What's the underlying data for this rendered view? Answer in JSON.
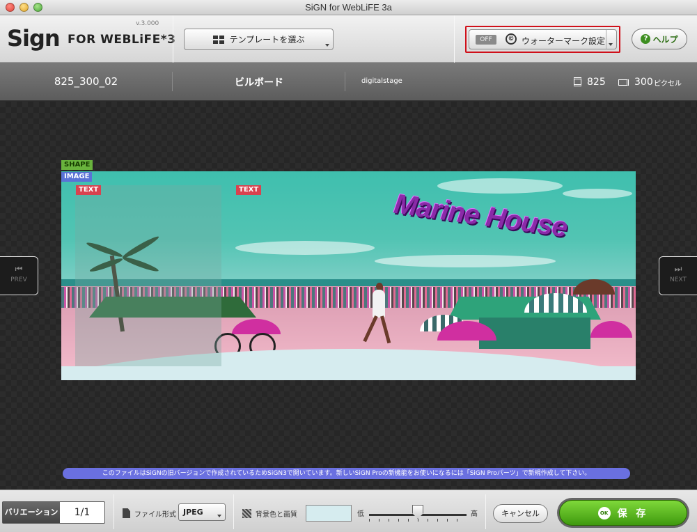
{
  "window": {
    "title": "SiGN for WebLiFE 3a"
  },
  "toolbar": {
    "logo_sign": "Sign",
    "logo_rest": "FOR WEBLiFE*3",
    "version": "v.3.000",
    "template_button": "テンプレートを選ぶ",
    "watermark_toggle": "OFF",
    "watermark_icon": "©",
    "watermark_button": "ウォーターマーク設定",
    "help_icon": "?",
    "help_button": "ヘルプ",
    "highlight_color": "#d0101a"
  },
  "info": {
    "template_name": "825_300_02",
    "category": "ビルボード",
    "author": "digitalstage",
    "height": "825",
    "width": "300",
    "unit": "ピクセル"
  },
  "canvas": {
    "prev_label": "PREV",
    "next_label": "NEXT",
    "prev_icon": "⏮",
    "next_icon": "⏭",
    "layer_tags": {
      "shape": "SHAPE",
      "image": "IMAGE",
      "text1": "TEXT",
      "text2": "TEXT"
    },
    "banner_text": "Marine House",
    "notice": "このファイルはSiGNの旧バージョンで作成されているためSiGN3で開いています。新しいSiGN Proの新機能をお使いになるには「SiGN Proパーツ」で新規作成して下さい。"
  },
  "bottom": {
    "variation_label": "バリエーション",
    "variation_count": "1/1",
    "file_format_label": "ファイル形式",
    "file_format_value": "JPEG",
    "bg_quality_label": "背景色と画質",
    "bg_color": "#d6ecef",
    "quality_low": "低",
    "quality_high": "高",
    "quality_level": 0.5,
    "cancel_button": "キャンセル",
    "save_icon": "OK",
    "save_button": "保 存"
  }
}
